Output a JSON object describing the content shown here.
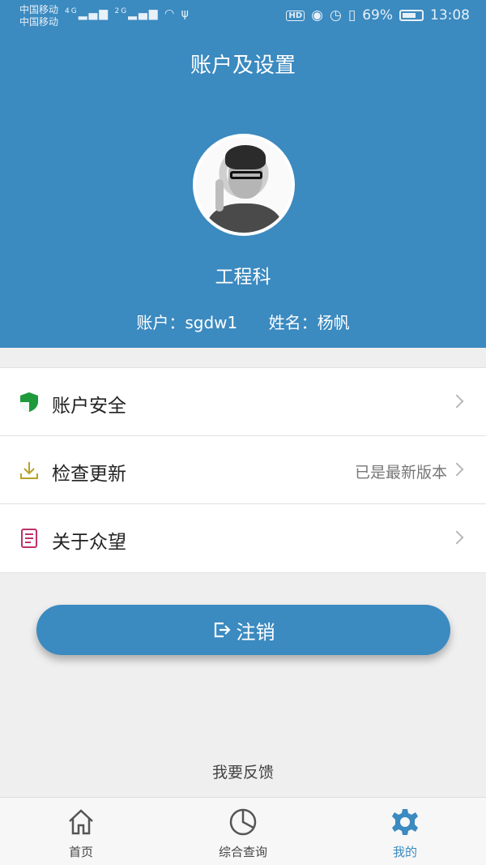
{
  "statusbar": {
    "carrier1": "中国移动",
    "carrier2": "中国移动",
    "signal1": "4G",
    "signal2": "2G",
    "hd": "HD",
    "battery_pct": "69%",
    "time": "13:08"
  },
  "header": {
    "title": "账户及设置",
    "department": "工程科",
    "account_label": "账户：sgdw1",
    "name_label": "姓名：杨帆"
  },
  "menu": {
    "items": [
      {
        "label": "账户安全",
        "value": "",
        "icon": "shield-icon"
      },
      {
        "label": "检查更新",
        "value": "已是最新版本",
        "icon": "download-icon"
      },
      {
        "label": "关于众望",
        "value": "",
        "icon": "document-icon"
      }
    ]
  },
  "logout": {
    "label": "注销",
    "icon": "logout-icon"
  },
  "feedback": {
    "label": "我要反馈"
  },
  "tabbar": {
    "tabs": [
      {
        "label": "首页",
        "icon": "home-icon"
      },
      {
        "label": "综合查询",
        "icon": "pie-chart-icon"
      },
      {
        "label": "我的",
        "icon": "gear-icon"
      }
    ]
  },
  "colors": {
    "primary": "#3b8ac0",
    "shield_green": "#1e9a3c",
    "download_olive": "#b8a12a",
    "document_pink": "#c0306a"
  }
}
